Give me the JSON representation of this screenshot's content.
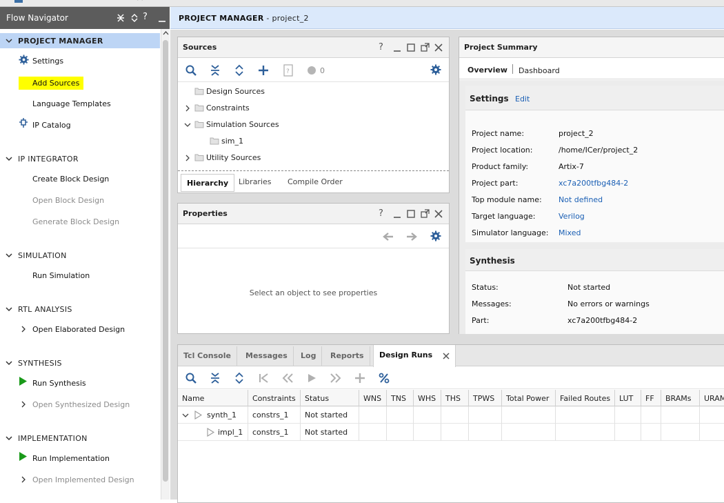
{
  "colors": {
    "accent": "#1a5fb4",
    "highlight": "#ffff00",
    "nav_header": "#5c5c5c",
    "selected_section": "#bdd5f5",
    "play_green": "#1a9a1a"
  },
  "flow_navigator": {
    "title": "Flow Navigator",
    "sections": [
      {
        "label": "PROJECT MANAGER",
        "expanded": true,
        "selected": true,
        "items": [
          {
            "label": "Settings",
            "icon": "gear-icon",
            "enabled": true
          },
          {
            "label": "Add Sources",
            "icon": "",
            "enabled": true,
            "highlighted": true
          },
          {
            "label": "Language Templates",
            "icon": "",
            "enabled": true
          },
          {
            "label": "IP Catalog",
            "icon": "ip-plug-icon",
            "enabled": true
          }
        ]
      },
      {
        "label": "IP INTEGRATOR",
        "expanded": true,
        "items": [
          {
            "label": "Create Block Design",
            "enabled": true
          },
          {
            "label": "Open Block Design",
            "enabled": false
          },
          {
            "label": "Generate Block Design",
            "enabled": false
          }
        ]
      },
      {
        "label": "SIMULATION",
        "expanded": true,
        "items": [
          {
            "label": "Run Simulation",
            "enabled": true
          }
        ]
      },
      {
        "label": "RTL ANALYSIS",
        "expanded": true,
        "items": [
          {
            "label": "Open Elaborated Design",
            "enabled": true,
            "expandable": true
          }
        ]
      },
      {
        "label": "SYNTHESIS",
        "expanded": true,
        "items": [
          {
            "label": "Run Synthesis",
            "icon": "play-icon",
            "enabled": true
          },
          {
            "label": "Open Synthesized Design",
            "enabled": false,
            "expandable": true
          }
        ]
      },
      {
        "label": "IMPLEMENTATION",
        "expanded": true,
        "items": [
          {
            "label": "Run Implementation",
            "icon": "play-icon",
            "enabled": true
          },
          {
            "label": "Open Implemented Design",
            "enabled": false,
            "expandable": true
          }
        ]
      }
    ]
  },
  "main_header": {
    "title": "PROJECT MANAGER",
    "separator": " - ",
    "project": "project_2"
  },
  "sources": {
    "title": "Sources",
    "badge_count": "0",
    "tree": [
      {
        "label": "Design Sources",
        "expander": "none",
        "depth": 0
      },
      {
        "label": "Constraints",
        "expander": "collapsed",
        "depth": 0
      },
      {
        "label": "Simulation Sources",
        "expander": "expanded",
        "depth": 0
      },
      {
        "label": "sim_1",
        "expander": "none",
        "depth": 1
      },
      {
        "label": "Utility Sources",
        "expander": "collapsed",
        "depth": 0
      }
    ],
    "tabs": [
      "Hierarchy",
      "Libraries",
      "Compile Order"
    ],
    "active_tab": "Hierarchy"
  },
  "properties": {
    "title": "Properties",
    "empty_message": "Select an object to see properties"
  },
  "project_summary": {
    "title": "Project Summary",
    "tabs": [
      "Overview",
      "Dashboard"
    ],
    "active_tab": "Overview",
    "settings": {
      "heading": "Settings",
      "edit_label": "Edit",
      "rows": [
        {
          "label": "Project name:",
          "value": "project_2",
          "link": false
        },
        {
          "label": "Project location:",
          "value": "/home/ICer/project_2",
          "link": false
        },
        {
          "label": "Product family:",
          "value": "Artix-7",
          "link": false
        },
        {
          "label": "Project part:",
          "value": "xc7a200tfbg484-2",
          "link": true
        },
        {
          "label": "Top module name:",
          "value": "Not defined",
          "link": true
        },
        {
          "label": "Target language:",
          "value": "Verilog",
          "link": true
        },
        {
          "label": "Simulator language:",
          "value": "Mixed",
          "link": true
        }
      ]
    },
    "synthesis": {
      "heading": "Synthesis",
      "rows": [
        {
          "label": "Status:",
          "value": "Not started"
        },
        {
          "label": "Messages:",
          "value": "No errors or warnings"
        },
        {
          "label": "Part:",
          "value": "xc7a200tfbg484-2"
        }
      ]
    }
  },
  "bottom_panel": {
    "tabs": [
      "Tcl Console",
      "Messages",
      "Log",
      "Reports",
      "Design Runs"
    ],
    "active_tab": "Design Runs",
    "columns": [
      "Name",
      "Constraints",
      "Status",
      "WNS",
      "TNS",
      "WHS",
      "THS",
      "TPWS",
      "Total Power",
      "Failed Routes",
      "LUT",
      "FF",
      "BRAMs",
      "URAM"
    ],
    "rows": [
      {
        "name": "synth_1",
        "constraints": "constrs_1",
        "status": "Not started",
        "expanded": true,
        "depth": 0
      },
      {
        "name": "impl_1",
        "constraints": "constrs_1",
        "status": "Not started",
        "expanded": false,
        "depth": 1
      }
    ]
  }
}
